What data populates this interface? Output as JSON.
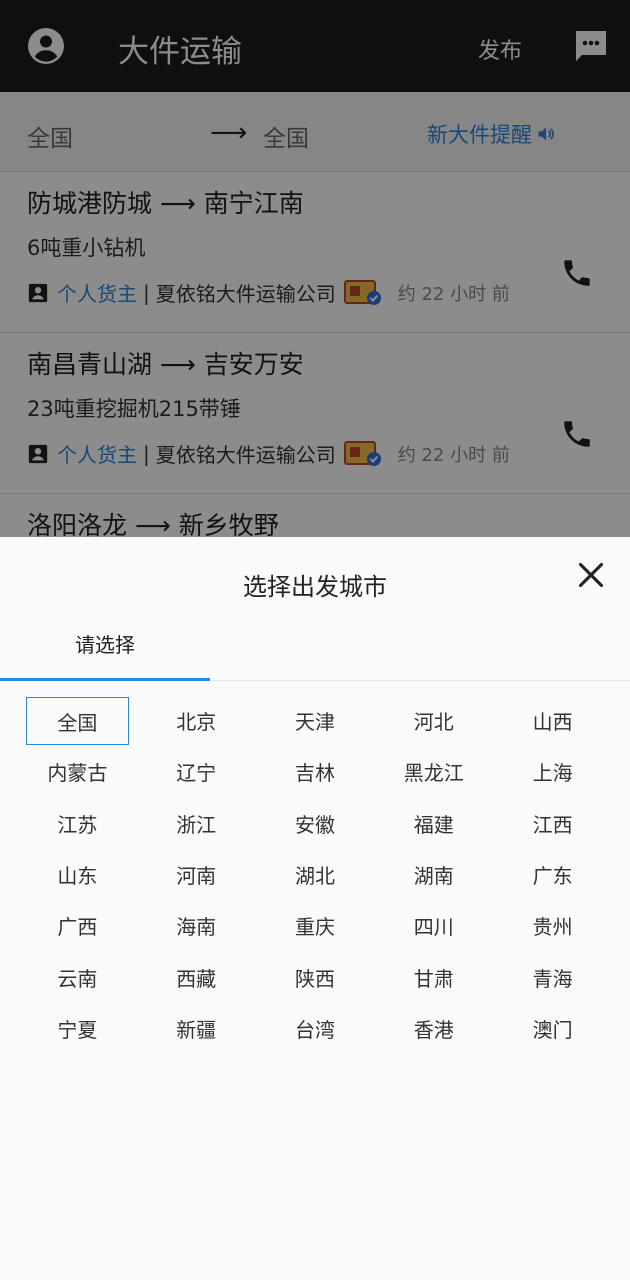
{
  "appbar": {
    "title": "大件运输",
    "publish_label": "发布",
    "avatar_icon": "account-circle-icon",
    "message_icon": "message-icon"
  },
  "filter": {
    "from": "全国",
    "arrow": "⟶",
    "to": "全国",
    "remind_label": "新大件提醒",
    "remind_icon": "speaker-icon"
  },
  "listings": [
    {
      "route": "防城港防城 ⟶ 南宁江南",
      "cargo": "6吨重小钻机",
      "owner": "个人货主",
      "company": "夏依铭大件运输公司",
      "time": "约 22 小时 前"
    },
    {
      "route": "南昌青山湖 ⟶ 吉安万安",
      "cargo": "23吨重挖掘机215带锤",
      "owner": "个人货主",
      "company": "夏依铭大件运输公司",
      "time": "约 22 小时 前"
    },
    {
      "route": "洛阳洛龙 ⟶ 新乡牧野"
    }
  ],
  "sheet": {
    "title": "选择出发城市",
    "tab_label": "请选择",
    "selected": "全国",
    "cities": [
      "全国",
      "北京",
      "天津",
      "河北",
      "山西",
      "内蒙古",
      "辽宁",
      "吉林",
      "黑龙江",
      "上海",
      "江苏",
      "浙江",
      "安徽",
      "福建",
      "江西",
      "山东",
      "河南",
      "湖北",
      "湖南",
      "广东",
      "广西",
      "海南",
      "重庆",
      "四川",
      "贵州",
      "云南",
      "西藏",
      "陕西",
      "甘肃",
      "青海",
      "宁夏",
      "新疆",
      "台湾",
      "香港",
      "澳门"
    ]
  },
  "colors": {
    "accent": "#2d86d9",
    "appbar": "#1d1d1d"
  }
}
